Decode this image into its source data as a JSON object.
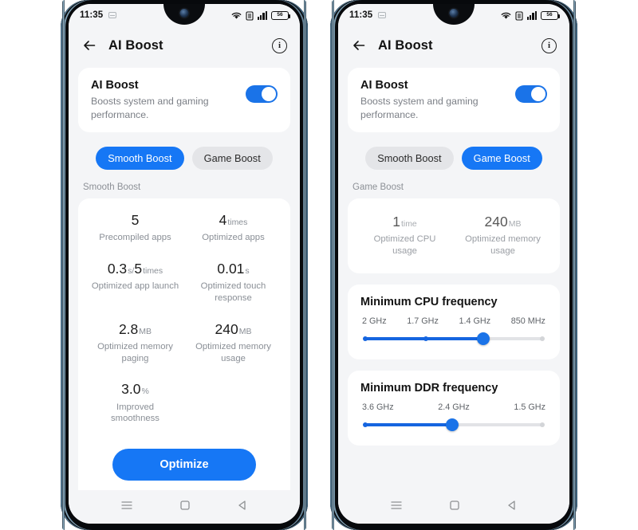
{
  "statusbar": {
    "time": "11:35",
    "icons": [
      "mute-icon",
      "wifi-icon",
      "sim-icon",
      "signal-bars-icon",
      "battery-icon"
    ],
    "battery_level": "56"
  },
  "appbar": {
    "back_icon": "back-arrow-icon",
    "title": "AI Boost",
    "info_icon": "info-circle-icon",
    "info_label": "i"
  },
  "hero": {
    "title": "AI Boost",
    "subtitle": "Boosts system and gaming performance.",
    "toggle_state": "on",
    "accent_color": "#1a73e8"
  },
  "tabs": {
    "smooth": "Smooth Boost",
    "game": "Game Boost"
  },
  "phone_left": {
    "active_tab": "Smooth Boost",
    "section_label": "Smooth Boost",
    "stats": [
      [
        {
          "value": "5",
          "unit": "",
          "label": "Precompiled apps"
        },
        {
          "value": "4",
          "unit": "times",
          "label": "Optimized apps"
        }
      ],
      [
        {
          "value": "0.3",
          "unit": "s/",
          "label": "Optimized app launch",
          "value2": "5",
          "unit2": "times"
        },
        {
          "value": "0.01",
          "unit": "s",
          "label": "Optimized touch response"
        }
      ],
      [
        {
          "value": "2.8",
          "unit": "MB",
          "label": "Optimized memory paging"
        },
        {
          "value": "240",
          "unit": "MB",
          "label": "Optimized memory usage"
        }
      ],
      [
        {
          "value": "3.0",
          "unit": "%",
          "label": "Improved smoothness"
        }
      ]
    ],
    "optimize_button": "Optimize"
  },
  "phone_right": {
    "active_tab": "Game Boost",
    "section_label": "Game Boost",
    "stats": [
      {
        "value": "1",
        "unit": "time",
        "label": "Optimized CPU usage"
      },
      {
        "value": "240",
        "unit": "MB",
        "label": "Optimized memory usage"
      }
    ],
    "cpu_slider": {
      "title": "Minimum CPU frequency",
      "ticks": [
        "2 GHz",
        "1.7 GHz",
        "1.4 GHz",
        "850 MHz"
      ],
      "selected_index": 2,
      "selected_value": "1.4 GHz"
    },
    "ddr_slider": {
      "title": "Minimum DDR frequency",
      "ticks": [
        "3.6 GHz",
        "2.4 GHz",
        "1.5 GHz"
      ],
      "selected_index": 1,
      "selected_value": "2.4 GHz"
    }
  },
  "navbar": {
    "recents": "recents-icon",
    "home": "home-icon",
    "back": "back-triangle-icon"
  }
}
